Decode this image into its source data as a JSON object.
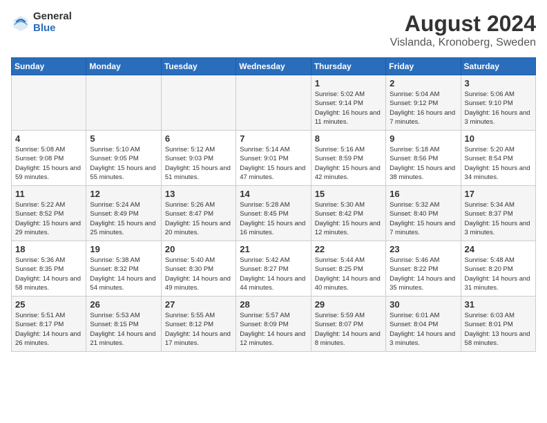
{
  "header": {
    "logo_general": "General",
    "logo_blue": "Blue",
    "main_title": "August 2024",
    "subtitle": "Vislanda, Kronoberg, Sweden"
  },
  "days_of_week": [
    "Sunday",
    "Monday",
    "Tuesday",
    "Wednesday",
    "Thursday",
    "Friday",
    "Saturday"
  ],
  "weeks": [
    [
      {
        "day": "",
        "info": ""
      },
      {
        "day": "",
        "info": ""
      },
      {
        "day": "",
        "info": ""
      },
      {
        "day": "",
        "info": ""
      },
      {
        "day": "1",
        "info": "Sunrise: 5:02 AM\nSunset: 9:14 PM\nDaylight: 16 hours\nand 11 minutes."
      },
      {
        "day": "2",
        "info": "Sunrise: 5:04 AM\nSunset: 9:12 PM\nDaylight: 16 hours\nand 7 minutes."
      },
      {
        "day": "3",
        "info": "Sunrise: 5:06 AM\nSunset: 9:10 PM\nDaylight: 16 hours\nand 3 minutes."
      }
    ],
    [
      {
        "day": "4",
        "info": "Sunrise: 5:08 AM\nSunset: 9:08 PM\nDaylight: 15 hours\nand 59 minutes."
      },
      {
        "day": "5",
        "info": "Sunrise: 5:10 AM\nSunset: 9:05 PM\nDaylight: 15 hours\nand 55 minutes."
      },
      {
        "day": "6",
        "info": "Sunrise: 5:12 AM\nSunset: 9:03 PM\nDaylight: 15 hours\nand 51 minutes."
      },
      {
        "day": "7",
        "info": "Sunrise: 5:14 AM\nSunset: 9:01 PM\nDaylight: 15 hours\nand 47 minutes."
      },
      {
        "day": "8",
        "info": "Sunrise: 5:16 AM\nSunset: 8:59 PM\nDaylight: 15 hours\nand 42 minutes."
      },
      {
        "day": "9",
        "info": "Sunrise: 5:18 AM\nSunset: 8:56 PM\nDaylight: 15 hours\nand 38 minutes."
      },
      {
        "day": "10",
        "info": "Sunrise: 5:20 AM\nSunset: 8:54 PM\nDaylight: 15 hours\nand 34 minutes."
      }
    ],
    [
      {
        "day": "11",
        "info": "Sunrise: 5:22 AM\nSunset: 8:52 PM\nDaylight: 15 hours\nand 29 minutes."
      },
      {
        "day": "12",
        "info": "Sunrise: 5:24 AM\nSunset: 8:49 PM\nDaylight: 15 hours\nand 25 minutes."
      },
      {
        "day": "13",
        "info": "Sunrise: 5:26 AM\nSunset: 8:47 PM\nDaylight: 15 hours\nand 20 minutes."
      },
      {
        "day": "14",
        "info": "Sunrise: 5:28 AM\nSunset: 8:45 PM\nDaylight: 15 hours\nand 16 minutes."
      },
      {
        "day": "15",
        "info": "Sunrise: 5:30 AM\nSunset: 8:42 PM\nDaylight: 15 hours\nand 12 minutes."
      },
      {
        "day": "16",
        "info": "Sunrise: 5:32 AM\nSunset: 8:40 PM\nDaylight: 15 hours\nand 7 minutes."
      },
      {
        "day": "17",
        "info": "Sunrise: 5:34 AM\nSunset: 8:37 PM\nDaylight: 15 hours\nand 3 minutes."
      }
    ],
    [
      {
        "day": "18",
        "info": "Sunrise: 5:36 AM\nSunset: 8:35 PM\nDaylight: 14 hours\nand 58 minutes."
      },
      {
        "day": "19",
        "info": "Sunrise: 5:38 AM\nSunset: 8:32 PM\nDaylight: 14 hours\nand 54 minutes."
      },
      {
        "day": "20",
        "info": "Sunrise: 5:40 AM\nSunset: 8:30 PM\nDaylight: 14 hours\nand 49 minutes."
      },
      {
        "day": "21",
        "info": "Sunrise: 5:42 AM\nSunset: 8:27 PM\nDaylight: 14 hours\nand 44 minutes."
      },
      {
        "day": "22",
        "info": "Sunrise: 5:44 AM\nSunset: 8:25 PM\nDaylight: 14 hours\nand 40 minutes."
      },
      {
        "day": "23",
        "info": "Sunrise: 5:46 AM\nSunset: 8:22 PM\nDaylight: 14 hours\nand 35 minutes."
      },
      {
        "day": "24",
        "info": "Sunrise: 5:48 AM\nSunset: 8:20 PM\nDaylight: 14 hours\nand 31 minutes."
      }
    ],
    [
      {
        "day": "25",
        "info": "Sunrise: 5:51 AM\nSunset: 8:17 PM\nDaylight: 14 hours\nand 26 minutes."
      },
      {
        "day": "26",
        "info": "Sunrise: 5:53 AM\nSunset: 8:15 PM\nDaylight: 14 hours\nand 21 minutes."
      },
      {
        "day": "27",
        "info": "Sunrise: 5:55 AM\nSunset: 8:12 PM\nDaylight: 14 hours\nand 17 minutes."
      },
      {
        "day": "28",
        "info": "Sunrise: 5:57 AM\nSunset: 8:09 PM\nDaylight: 14 hours\nand 12 minutes."
      },
      {
        "day": "29",
        "info": "Sunrise: 5:59 AM\nSunset: 8:07 PM\nDaylight: 14 hours\nand 8 minutes."
      },
      {
        "day": "30",
        "info": "Sunrise: 6:01 AM\nSunset: 8:04 PM\nDaylight: 14 hours\nand 3 minutes."
      },
      {
        "day": "31",
        "info": "Sunrise: 6:03 AM\nSunset: 8:01 PM\nDaylight: 13 hours\nand 58 minutes."
      }
    ]
  ]
}
